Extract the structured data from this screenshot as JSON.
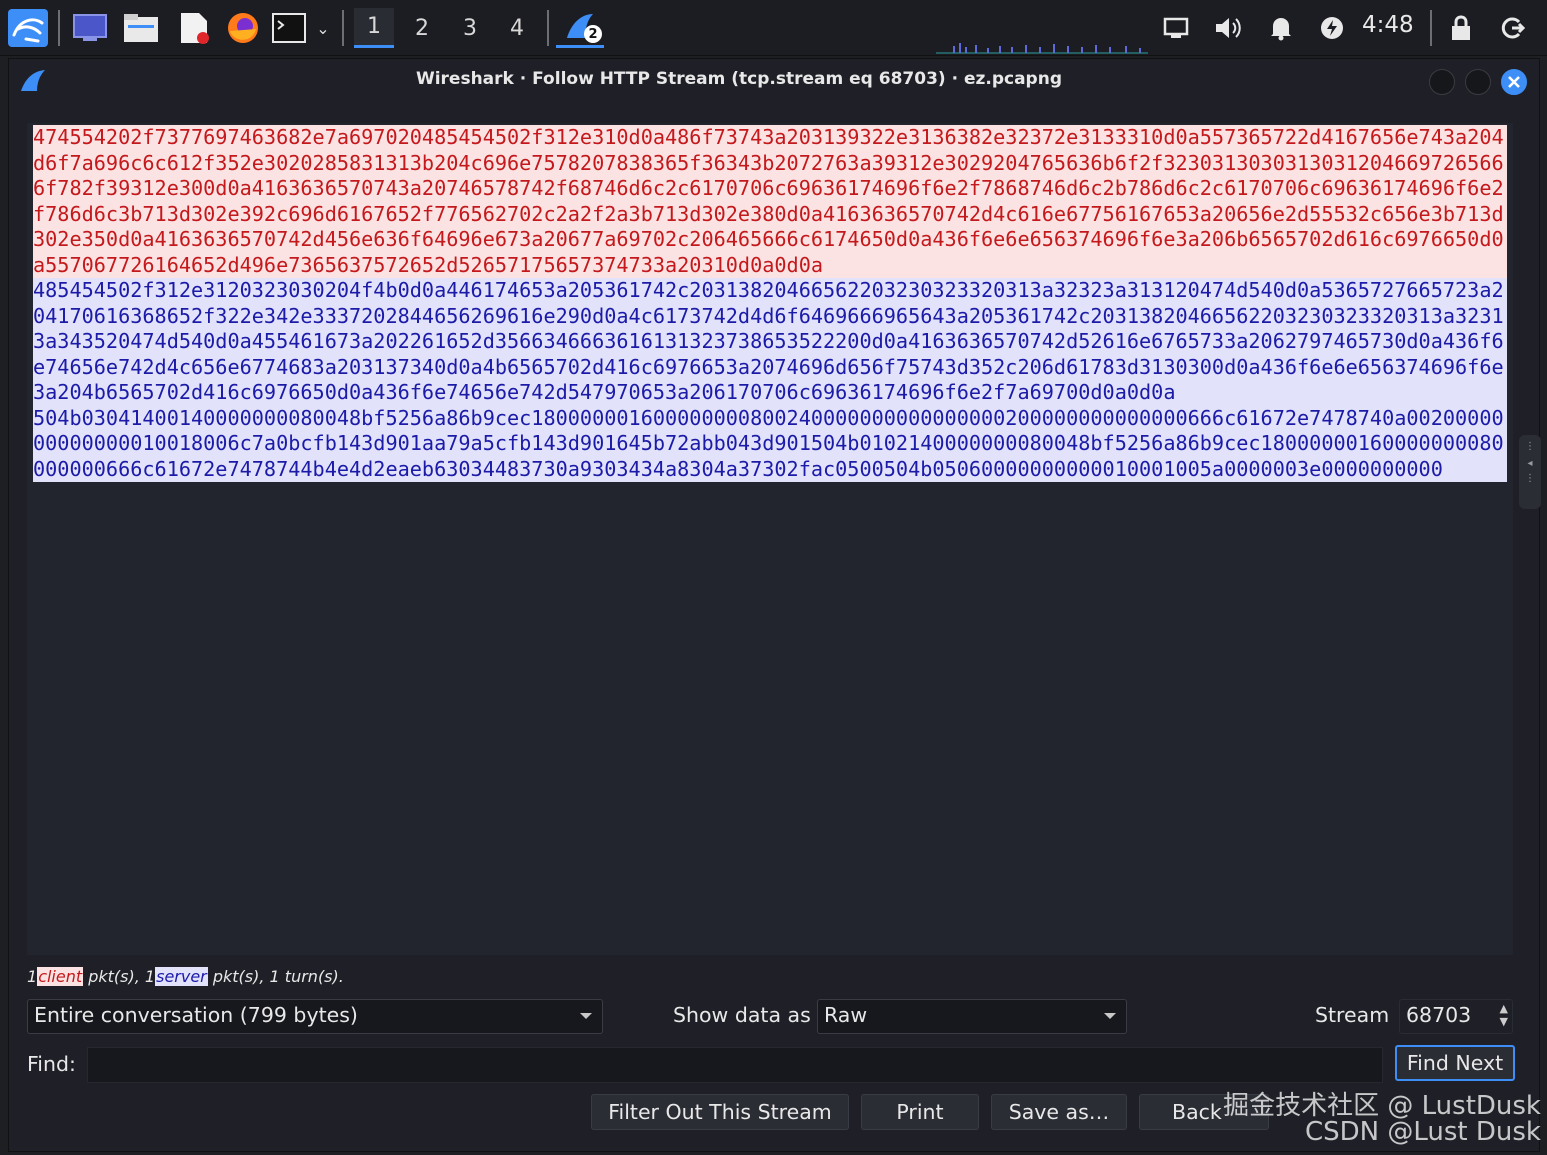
{
  "taskbar": {
    "workspaces": [
      "1",
      "2",
      "3",
      "4"
    ],
    "active_workspace": "1",
    "wireshark_badge": "2",
    "clock": "4:48",
    "launchers": [
      "kali-menu-icon",
      "desktop-icon",
      "file-manager-icon",
      "text-editor-icon",
      "firefox-icon",
      "terminal-icon"
    ]
  },
  "window": {
    "title": "Wireshark · Follow HTTP Stream (tcp.stream eq 68703) · ez.pcapng"
  },
  "stream": {
    "segments": [
      {
        "side": "client",
        "text": "474554202f7377697463682e7a697020485454502f312e310d0a486f73743a203139322e3136382e32372e3133310d0a557365722d4167656e743a204d6f7a696c6c612f352e3020285831313b204c696e7578207838365f36343b2072763a39312e3029204765636b6f2f32303130303130312046697265666f782f39312e300d0a4163636570743a20746578742f68746d6c2c6170706c69636174696f6e2f7868746d6c2b786d6c2c6170706c69636174696f6e2f786d6c3b713d302e392c696d6167652f776562702c2a2f2a3b713d302e380d0a4163636570742d4c616e67756167653a20656e2d55532c656e3b713d302e350d0a4163636570742d456e636f64696e673a20677a69702c206465666c6174650d0a436f6e6e656374696f6e3a206b6565702d616c6976650d0a557067726164652d496e7365637572652d52657175657374733a20310d0a0d0a"
      },
      {
        "side": "server",
        "text": "485454502f312e3120323030204f4b0d0a446174653a205361742c20313820466562203230323320313a32323a313120474d540d0a5365727665723a204170616368652f322e342e3337202844656269616e290d0a4c6173742d4d6f6469666965643a205361742c20313820466562203230323320313a32313a343520474d540d0a455461673a202261652d3566346663616131323738653522200d0a4163636570742d52616e6765733a2062797465730d0a436f6e74656e742d4c656e6774683a203137340d0a4b6565702d416c6976653a2074696d656f75743d352c206d61783d3130300d0a436f6e6e656374696f6e3a204b6565702d416c6976650d0a436f6e74656e742d547970653a206170706c69636174696f6e2f7a69700d0a0d0a"
      },
      {
        "side": "server",
        "text": "504b03041400140000000080048bf5256a86b9cec180000001600000000800240000000000000000200000000000000666c61672e7478740a0020000000000000010018006c7a0bcfb143d901aa79a5cfb143d901645b72abb043d901504b0102140000000080048bf5256a86b9cec18000000160000000080000000666c61672e7478744b4e4d2eaeb63034483730a9303434a8304a37302fac0500504b05060000000000010001005a0000003e0000000000"
      }
    ]
  },
  "summary": {
    "client_count": "1",
    "client_label": "client",
    "middle": " pkt(s), ",
    "server_count": "1",
    "server_label": "server",
    "tail": " pkt(s), 1 turn(s)."
  },
  "controls": {
    "conversation_select": "Entire conversation (799 bytes)",
    "show_data_label": "Show data as",
    "show_data_select": "Raw",
    "stream_label": "Stream",
    "stream_value": "68703",
    "find_label": "Find:",
    "find_value": "",
    "find_next": "Find Next"
  },
  "buttons": {
    "filter_out": "Filter Out This Stream",
    "print": "Print",
    "save_as": "Save as…",
    "back": "Back"
  },
  "watermark": {
    "line1": "掘金技术社区 @ LustDusk",
    "line2": "CSDN @Lust Dusk"
  },
  "colors": {
    "client_bg": "#fbe3e3",
    "client_fg": "#c4191c",
    "server_bg": "#e2e2fb",
    "server_fg": "#1b1ba8",
    "accent": "#3d8ef7"
  }
}
